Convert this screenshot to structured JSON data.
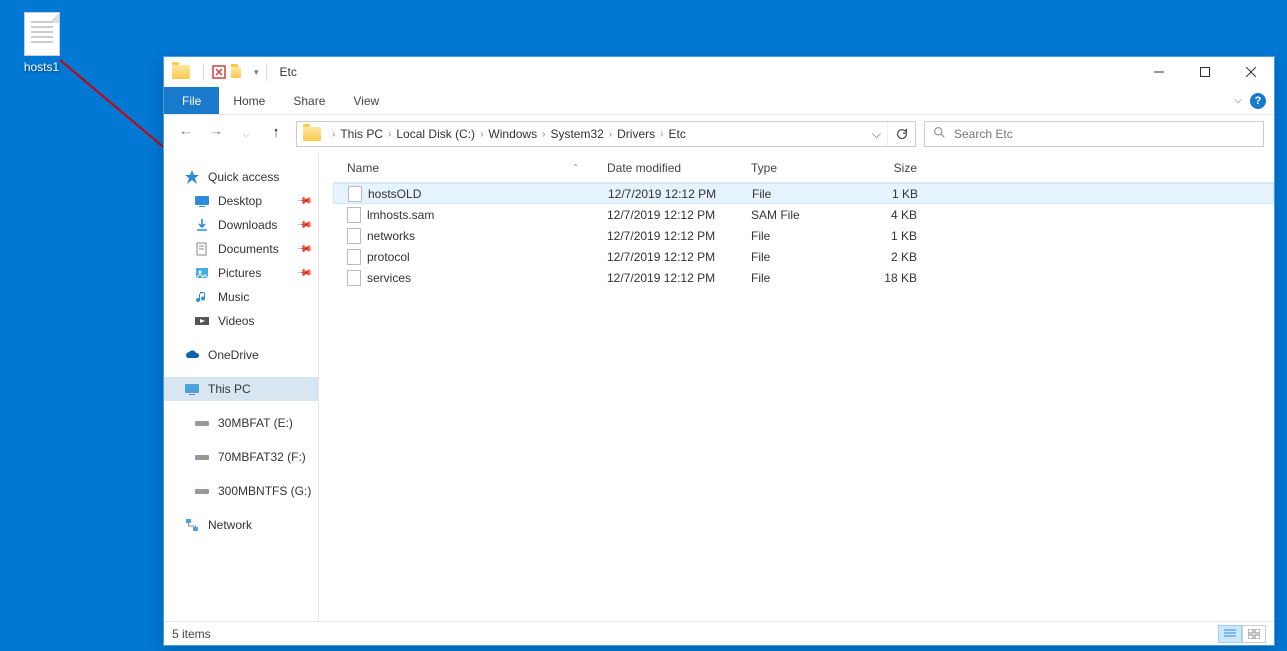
{
  "desktop": {
    "file_label": "hosts1"
  },
  "window": {
    "title": "Etc"
  },
  "ribbon": {
    "file": "File",
    "home": "Home",
    "share": "Share",
    "view": "View"
  },
  "breadcrumb": [
    "This PC",
    "Local Disk (C:)",
    "Windows",
    "System32",
    "Drivers",
    "Etc"
  ],
  "search": {
    "placeholder": "Search Etc"
  },
  "columns": {
    "name": "Name",
    "date": "Date modified",
    "type": "Type",
    "size": "Size"
  },
  "nav": {
    "quick_access": "Quick access",
    "desktop": "Desktop",
    "downloads": "Downloads",
    "documents": "Documents",
    "pictures": "Pictures",
    "music": "Music",
    "videos": "Videos",
    "onedrive": "OneDrive",
    "this_pc": "This PC",
    "drive_e": "30MBFAT (E:)",
    "drive_f": "70MBFAT32 (F:)",
    "drive_g": "300MBNTFS (G:)",
    "network": "Network"
  },
  "files": [
    {
      "name": "hostsOLD",
      "date": "12/7/2019 12:12 PM",
      "type": "File",
      "size": "1 KB"
    },
    {
      "name": "lmhosts.sam",
      "date": "12/7/2019 12:12 PM",
      "type": "SAM File",
      "size": "4 KB"
    },
    {
      "name": "networks",
      "date": "12/7/2019 12:12 PM",
      "type": "File",
      "size": "1 KB"
    },
    {
      "name": "protocol",
      "date": "12/7/2019 12:12 PM",
      "type": "File",
      "size": "2 KB"
    },
    {
      "name": "services",
      "date": "12/7/2019 12:12 PM",
      "type": "File",
      "size": "18 KB"
    }
  ],
  "status": {
    "items": "5 items"
  }
}
